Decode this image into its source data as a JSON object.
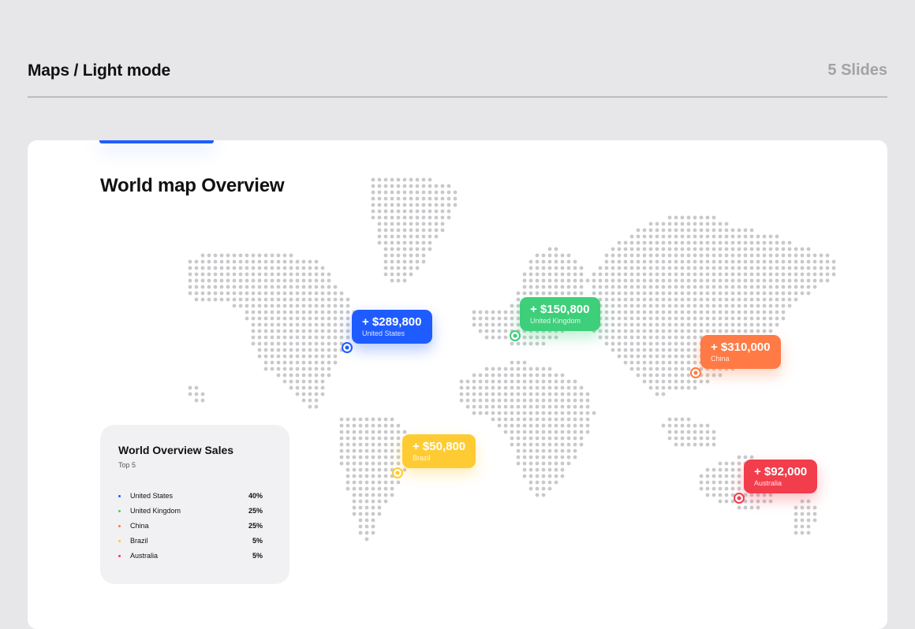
{
  "header": {
    "title": "Maps / Light mode",
    "slide_count": "5 Slides"
  },
  "card": {
    "title": "World map Overview"
  },
  "colors": {
    "blue": "#1f5cff",
    "green": "#3ecf7a",
    "orange": "#ff7a45",
    "yellow": "#ffcb33",
    "red": "#f23d4c",
    "map_dot": "#c9c9cc"
  },
  "callouts": [
    {
      "amount": "+ $289,800",
      "country": "United States",
      "color": "#1f5cff"
    },
    {
      "amount": "+ $150,800",
      "country": "United Kingdom",
      "color": "#3ecf7a"
    },
    {
      "amount": "+ $310,000",
      "country": "China",
      "color": "#ff7a45"
    },
    {
      "amount": "+ $50,800",
      "country": "Brazil",
      "color": "#ffcb33"
    },
    {
      "amount": "+ $92,000",
      "country": "Australia",
      "color": "#f23d4c"
    }
  ],
  "panel": {
    "title": "World Overview Sales",
    "subtitle": "Top 5",
    "rows": [
      {
        "name": "United States",
        "pct": "40%",
        "color": "#1f5cff"
      },
      {
        "name": "United Kingdom",
        "pct": "25%",
        "color": "#3ecf7a"
      },
      {
        "name": "China",
        "pct": "25%",
        "color": "#ff7a45"
      },
      {
        "name": "Brazil",
        "pct": "5%",
        "color": "#ffcb33"
      },
      {
        "name": "Australia",
        "pct": "5%",
        "color": "#f23d4c"
      }
    ]
  }
}
